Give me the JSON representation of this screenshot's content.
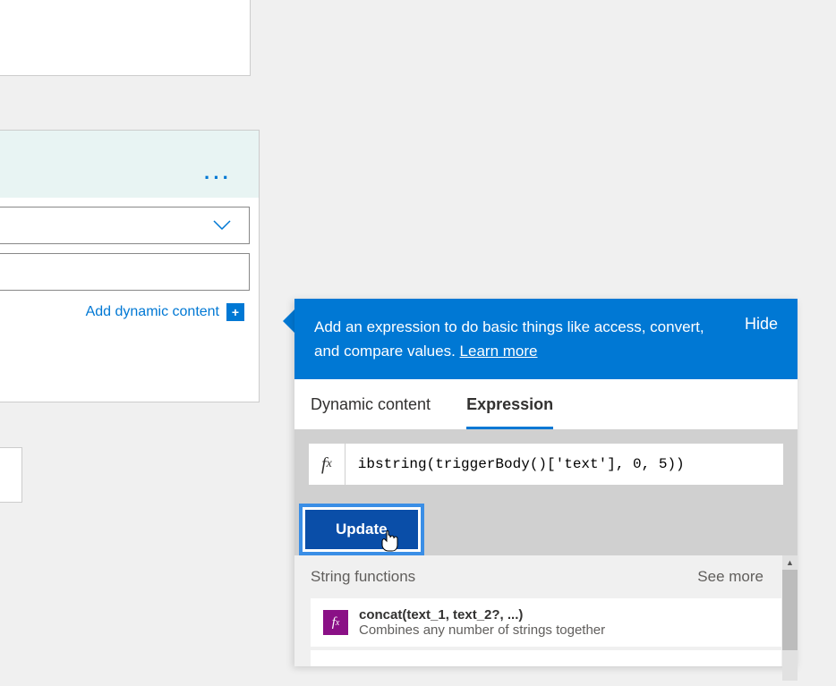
{
  "left_panel": {
    "add_dynamic_label": "Add dynamic content"
  },
  "expr_panel": {
    "header_text_1": "Add an expression to do basic things like access, convert, and compare values. ",
    "learn_more": "Learn more",
    "hide": "Hide",
    "tabs": {
      "dynamic": "Dynamic content",
      "expression": "Expression"
    },
    "fx_label": "fx",
    "expression_input": "ibstring(triggerBody()['text'], 0, 5))",
    "update_label": "Update",
    "section_title": "String functions",
    "see_more": "See more",
    "functions": [
      {
        "name": "concat(text_1, text_2?, ...)",
        "desc": "Combines any number of strings together"
      }
    ]
  }
}
